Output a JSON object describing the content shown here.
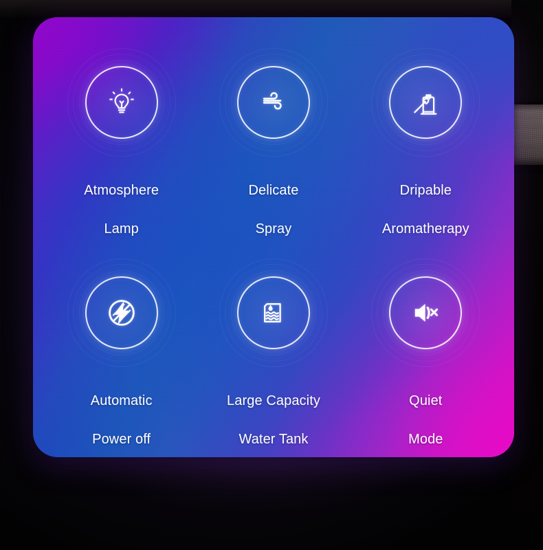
{
  "card": {
    "gradient_start": "#8a09c4",
    "gradient_mid": "#1f5ab9",
    "gradient_end": "#e10cc4",
    "corner_radius_px": 36
  },
  "background": {
    "base_color": "#050404",
    "fabric_patch_color": "#5b4f4d"
  },
  "features": [
    {
      "id": "atmosphere-lamp",
      "icon": "lightbulb-icon",
      "label_line1": "Atmosphere",
      "label_line2": "Lamp"
    },
    {
      "id": "delicate-spray",
      "icon": "wind-spray-icon",
      "label_line1": "Delicate",
      "label_line2": "Spray"
    },
    {
      "id": "dripable-aromatherapy",
      "icon": "dropper-bottle-icon",
      "label_line1": "Dripable",
      "label_line2": "Aromatherapy"
    },
    {
      "id": "automatic-power-off",
      "icon": "power-off-bolt-icon",
      "label_line1": "Automatic",
      "label_line2": "Power off"
    },
    {
      "id": "large-capacity-water-tank",
      "icon": "water-tank-icon",
      "label_line1": "Large Capacity",
      "label_line2": "Water Tank"
    },
    {
      "id": "quiet-mode",
      "icon": "speaker-mute-icon",
      "label_line1": "Quiet",
      "label_line2": "Mode"
    }
  ]
}
